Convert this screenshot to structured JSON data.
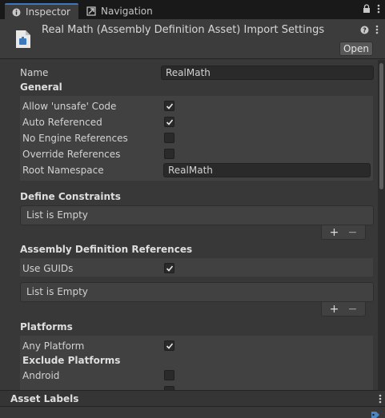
{
  "tabs": {
    "inspector": "Inspector",
    "navigation": "Navigation"
  },
  "header": {
    "title": "Real Math (Assembly Definition Asset) Import Settings",
    "open_label": "Open"
  },
  "name_row": {
    "label": "Name",
    "value": "RealMath"
  },
  "general": {
    "title": "General",
    "allow_unsafe": {
      "label": "Allow 'unsafe' Code",
      "checked": true
    },
    "auto_referenced": {
      "label": "Auto Referenced",
      "checked": true
    },
    "no_engine_refs": {
      "label": "No Engine References",
      "checked": false
    },
    "override_refs": {
      "label": "Override References",
      "checked": false
    },
    "root_namespace": {
      "label": "Root Namespace",
      "value": "RealMath"
    }
  },
  "define_constraints": {
    "title": "Define Constraints",
    "empty_text": "List is Empty"
  },
  "assembly_refs": {
    "title": "Assembly Definition References",
    "use_guids": {
      "label": "Use GUIDs",
      "checked": true
    },
    "empty_text": "List is Empty"
  },
  "platforms": {
    "title": "Platforms",
    "any_platform": {
      "label": "Any Platform",
      "checked": true
    },
    "exclude_title": "Exclude Platforms",
    "android": {
      "label": "Android",
      "checked": false
    }
  },
  "asset_labels": {
    "title": "Asset Labels"
  },
  "colors": {
    "accent": "#3a79bb",
    "background": "#383838",
    "tab_bar": "#191919"
  },
  "icons": [
    "info-icon",
    "navigation-icon",
    "lock-icon",
    "kebab-menu-icon",
    "help-icon",
    "settings-icon",
    "asmdef-icon",
    "check-icon",
    "plus-icon",
    "minus-icon",
    "tag-icon"
  ]
}
